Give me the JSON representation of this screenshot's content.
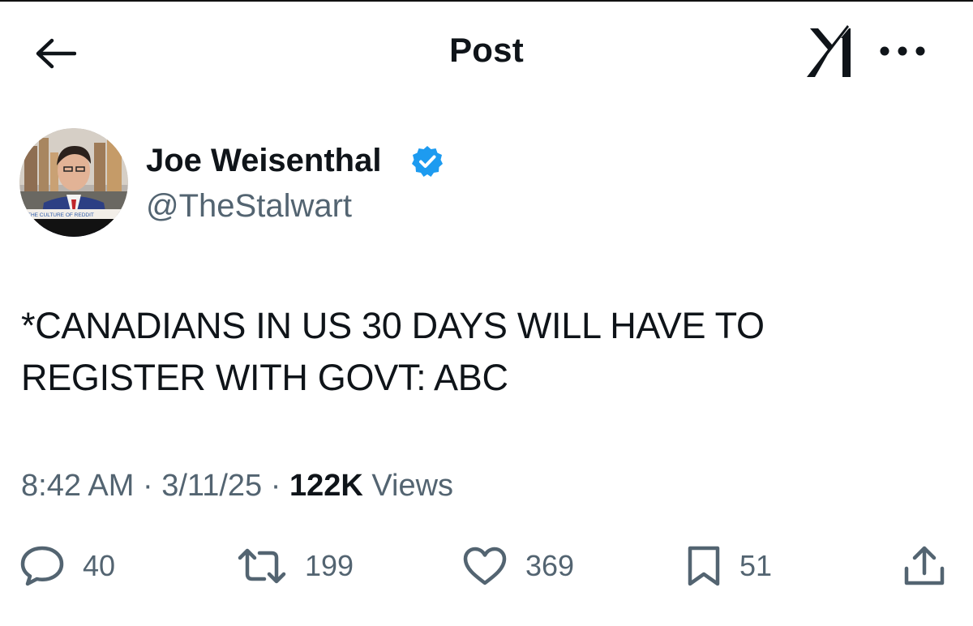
{
  "header": {
    "title": "Post"
  },
  "author": {
    "name": "Joe Weisenthal",
    "handle": "@TheStalwart",
    "avatar_caption": "THE CULTURE OF REDDIT"
  },
  "tweet": {
    "text": "*CANADIANS IN US 30 DAYS WILL HAVE TO REGISTER WITH GOVT: ABC"
  },
  "meta": {
    "time": "8:42 AM",
    "separator": "·",
    "date": "3/11/25",
    "views_count": "122K",
    "views_label": "Views"
  },
  "actions": {
    "replies": "40",
    "reposts": "199",
    "likes": "369",
    "bookmarks": "51"
  },
  "colors": {
    "text": "#0f1419",
    "secondary": "#536471",
    "verified": "#1d9bf0"
  }
}
